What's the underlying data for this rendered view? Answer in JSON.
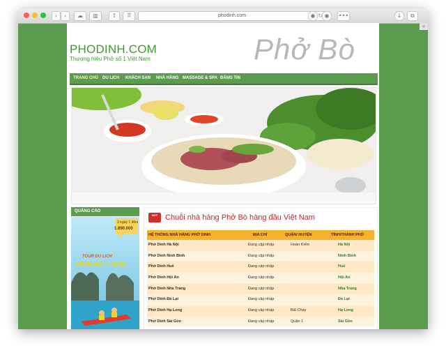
{
  "browser": {
    "address": "phodinh.com"
  },
  "site": {
    "logo": "PHODINH.COM",
    "tagline": "Thương hiệu Phở số 1 Việt Nam",
    "hero_title": "Phở Bò"
  },
  "nav": {
    "items": [
      "TRANG CHỦ",
      "DU LỊCH",
      "KHÁCH SẠN",
      "NHÀ HÀNG",
      "MASSAGE & SPA",
      "ĐĂNG TIN"
    ]
  },
  "sidebar": {
    "heading": "QUẢNG CÁO",
    "ad": {
      "duration": "2 ngày 1 đêm",
      "price": "1.890.000",
      "tour_label": "TOUR DU LỊCH",
      "destination": "VỊNH HẠ LONG"
    }
  },
  "main": {
    "hot_badge": "HOT",
    "title": "Chuỗi nhà hàng Phở Bò hàng đầu Việt Nam",
    "table": {
      "headers": [
        "HỆ THỐNG NHÀ HÀNG PHỞ DINH",
        "ĐỊA CHỈ",
        "QUẬN/ HUYỆN",
        "TỈNH/THÀNH PHỐ"
      ],
      "rows": [
        [
          "Phở Dinh Hà Nội",
          "Đang cập nhập",
          "Hoàn Kiếm",
          "Hà Nội"
        ],
        [
          "Phở Dinh Ninh Bình",
          "Đang cập nhập",
          "",
          "Ninh Bình"
        ],
        [
          "Phở Dinh Huế",
          "Đang cập nhập",
          "",
          "Huế"
        ],
        [
          "Phở Dinh Hội An",
          "Đang cập nhập",
          "",
          "Hội An"
        ],
        [
          "Phở Dinh Nha Trang",
          "Đang cập nhập",
          "",
          "Nha Trang"
        ],
        [
          "Phở Dinh Đà Lạt",
          "Đang cập nhập",
          "",
          "Đà Lạt"
        ],
        [
          "Phở Dinh Hạ Long",
          "Đang cập nhập",
          "Bãi Cháy",
          "Hạ Long"
        ],
        [
          "Phở Dinh Sài Gòn",
          "Đang cập nhập",
          "Quận 1",
          "Sài Gòn"
        ]
      ]
    }
  }
}
